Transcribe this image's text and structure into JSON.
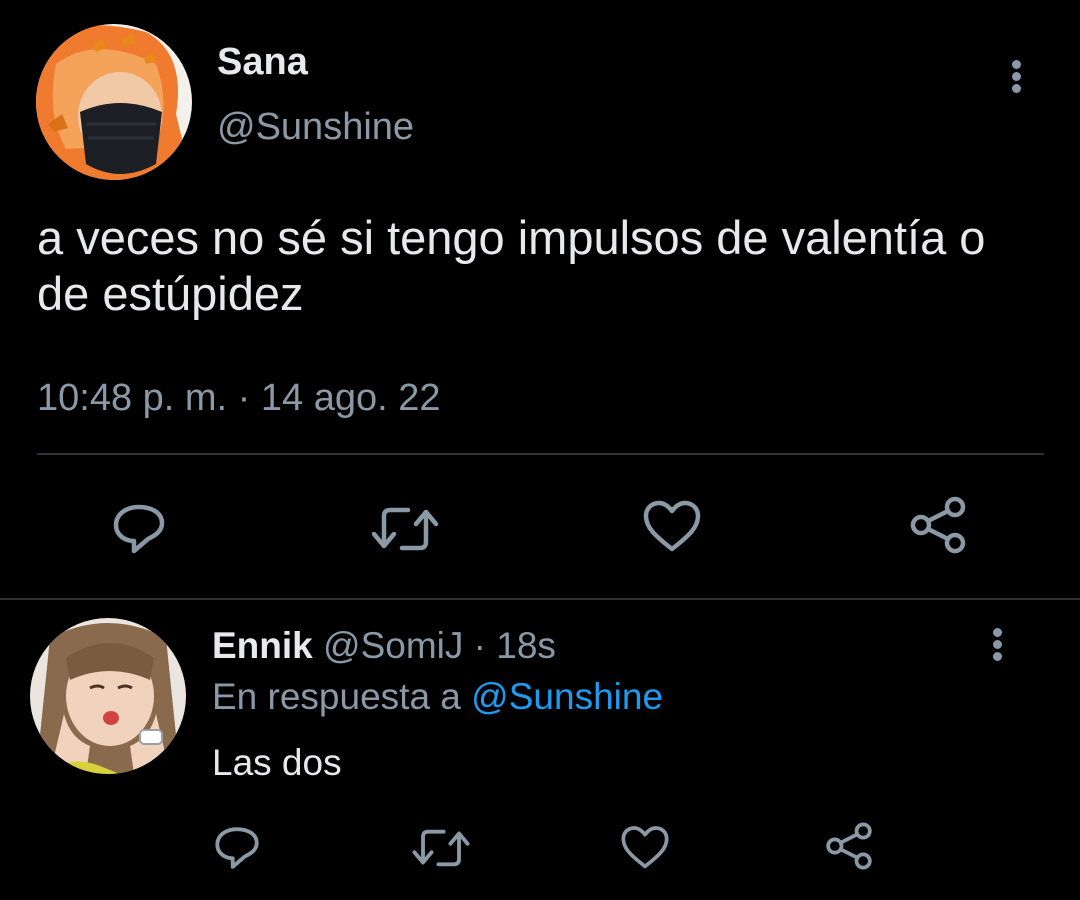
{
  "tweet": {
    "author": {
      "display_name": "Sana",
      "handle": "@Sunshine",
      "avatar": "avatar-orange-hair-mask-butterflies"
    },
    "text": "a veces no sé si tengo impulsos de valentía o de estúpidez",
    "timestamp": "10:48 p. m. · 14 ago. 22",
    "menu_icon": "more-vertical-icon",
    "actions": [
      "reply-icon",
      "retweet-icon",
      "like-icon",
      "share-icon"
    ]
  },
  "reply": {
    "author": {
      "display_name": "Ennik",
      "handle": "@SomiJ",
      "time": "· 18s",
      "avatar": "avatar-girl-hands-on-face"
    },
    "reply_to_prefix": "En respuesta a",
    "reply_to_handle": "@Sunshine",
    "text": "Las dos",
    "menu_icon": "more-vertical-icon",
    "actions": [
      "reply-icon",
      "retweet-icon",
      "like-icon",
      "share-icon"
    ]
  },
  "colors": {
    "background": "#000000",
    "primary_text": "#e7e9ea",
    "secondary_text": "#8b98a5",
    "accent": "#1d9bf0",
    "divider": "#2f3336"
  }
}
